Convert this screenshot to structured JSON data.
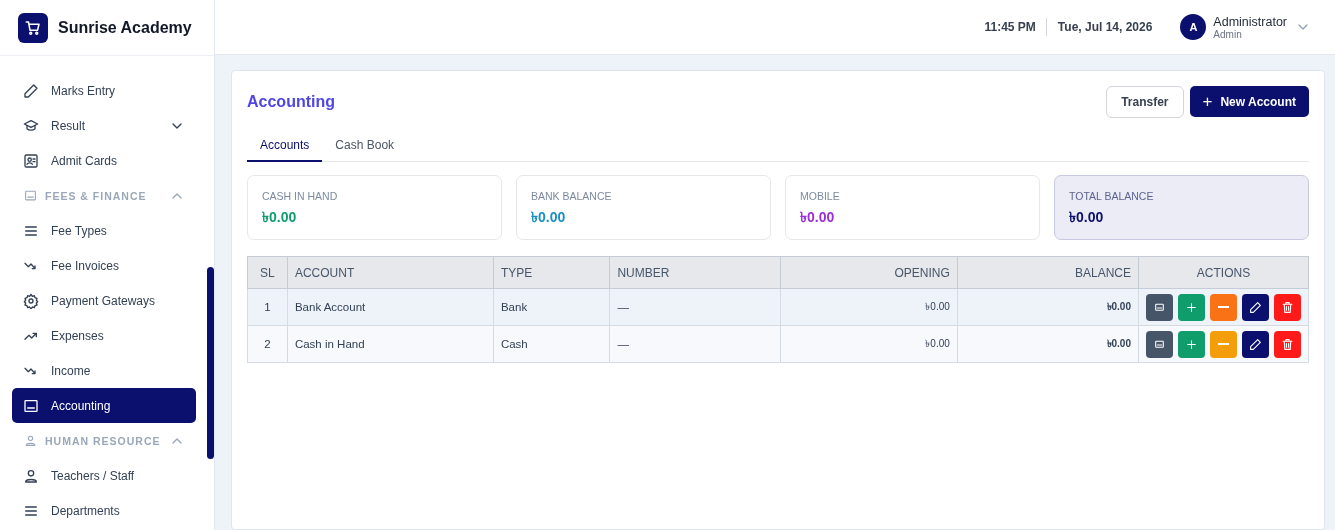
{
  "brand": {
    "name": "Sunrise Academy"
  },
  "sidebar": {
    "items": [
      {
        "kind": "item",
        "label": "Marks Entry",
        "selected": false
      },
      {
        "kind": "group",
        "label": "Result",
        "expanded": false,
        "selected": false
      },
      {
        "kind": "item",
        "label": "Admit Cards",
        "selected": false
      },
      {
        "kind": "section",
        "label": "FEES & FINANCE",
        "expanded": true
      },
      {
        "kind": "item",
        "label": "Fee Types",
        "selected": false
      },
      {
        "kind": "item",
        "label": "Fee Invoices",
        "selected": false
      },
      {
        "kind": "item",
        "label": "Payment Gateways",
        "selected": false
      },
      {
        "kind": "item",
        "label": "Expenses",
        "selected": false
      },
      {
        "kind": "item",
        "label": "Income",
        "selected": false
      },
      {
        "kind": "item",
        "label": "Accounting",
        "selected": true
      },
      {
        "kind": "section",
        "label": "HUMAN RESOURCE",
        "expanded": true
      },
      {
        "kind": "item",
        "label": "Teachers / Staff",
        "selected": false
      },
      {
        "kind": "item",
        "label": "Departments",
        "selected": false
      }
    ]
  },
  "header": {
    "time": "11:45 PM",
    "date": "Tue, Jul 14, 2026",
    "user": {
      "initial": "A",
      "name": "Administrator",
      "role": "Admin"
    }
  },
  "page": {
    "title": "Accounting",
    "buttons": [
      {
        "kind": "secondary",
        "label": "Transfer"
      },
      {
        "kind": "primary",
        "icon": "+",
        "label": "New Account"
      }
    ]
  },
  "tabs": [
    {
      "label": "Accounts",
      "selected": true
    },
    {
      "label": "Cash Book",
      "selected": false
    }
  ],
  "summary": [
    {
      "label": "CASH IN HAND",
      "value": "৳0.00",
      "color": "#0f9d6b",
      "highlighted": false
    },
    {
      "label": "BANK BALANCE",
      "value": "৳0.00",
      "color": "#1a8fc4",
      "highlighted": false
    },
    {
      "label": "MOBILE",
      "value": "৳0.00",
      "color": "#9b2fd6",
      "highlighted": false
    },
    {
      "label": "TOTAL BALANCE",
      "value": "৳0.00",
      "color": "#0b0f6e",
      "highlighted": true
    }
  ],
  "table": {
    "columns": [
      "SL",
      "ACCOUNT",
      "TYPE",
      "NUMBER",
      "OPENING",
      "BALANCE",
      "ACTIONS"
    ],
    "rows": [
      {
        "sl": "1",
        "account": "Bank Account",
        "type": "Bank",
        "number": "—",
        "opening": "৳0.00",
        "balance": "৳0.00",
        "selected": true
      },
      {
        "sl": "2",
        "account": "Cash in Hand",
        "type": "Cash",
        "number": "—",
        "opening": "৳0.00",
        "balance": "৳0.00",
        "selected": false
      }
    ]
  }
}
